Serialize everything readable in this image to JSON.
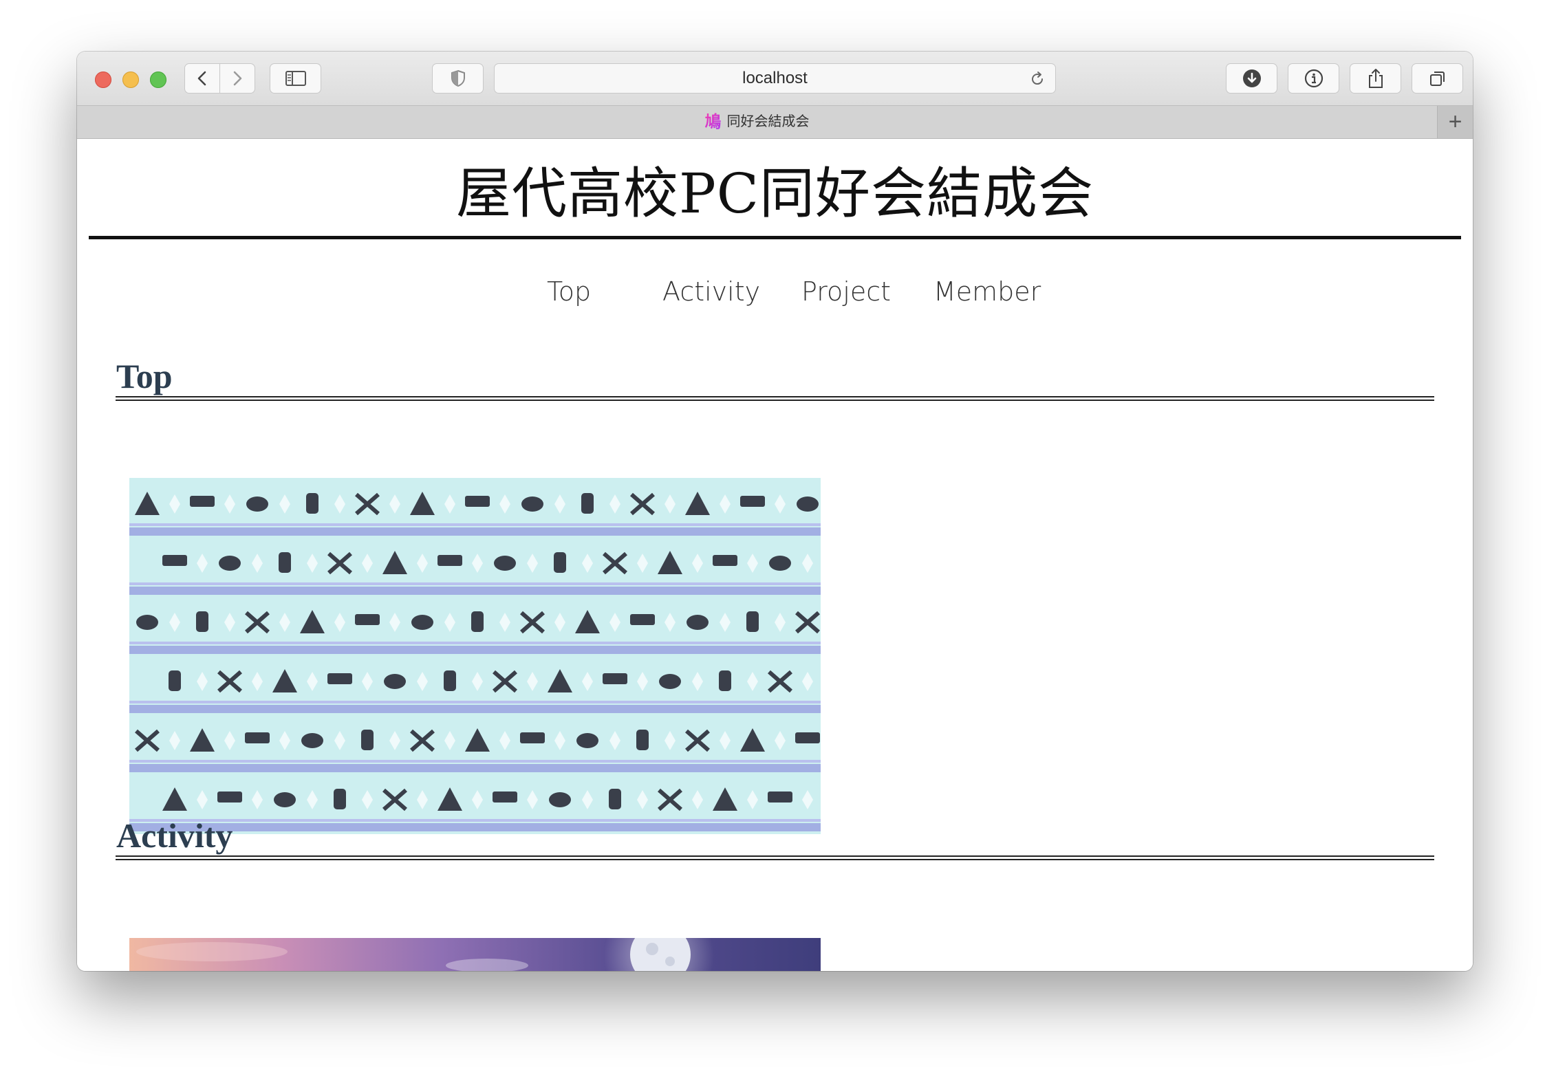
{
  "browser": {
    "url": "localhost",
    "tab_title": "同好会結成会",
    "favicon_char": "鳩",
    "new_tab_label": "+"
  },
  "site": {
    "title": "屋代高校PC同好会結成会",
    "nav": [
      "Top",
      "Activity",
      "Project",
      "Member"
    ]
  },
  "sections": [
    {
      "heading": "Top",
      "image": "camping-gear-pattern"
    },
    {
      "heading": "Activity",
      "image": "night-sky-moon"
    }
  ],
  "colors": {
    "heading": "#2c3e50",
    "pattern_bg": "#cdeff0",
    "pattern_icons": "#3a3f4a",
    "pattern_stripe": "#9aa3e0"
  }
}
